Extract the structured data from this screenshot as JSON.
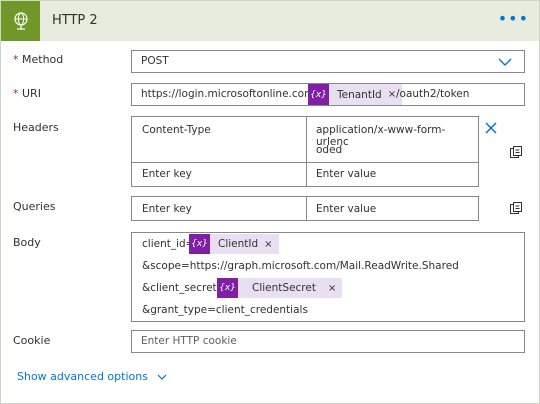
{
  "header": {
    "title": "HTTP 2",
    "icon": "globe-icon",
    "more_icon": "ellipsis-icon"
  },
  "method": {
    "label": "Method",
    "required_mark": "*",
    "value": "POST"
  },
  "uri": {
    "label": "URI",
    "required_mark": "*",
    "prefix": "https://login.microsoftonline.com/",
    "token": "TenantId",
    "suffix": "/oauth2/token"
  },
  "headers": {
    "label": "Headers",
    "rows": [
      {
        "key": "Content-Type",
        "value_line1": "application/x-www-form-urlenc",
        "value_line2": "oded"
      }
    ],
    "key_placeholder": "Enter key",
    "value_placeholder": "Enter value"
  },
  "queries": {
    "label": "Queries",
    "key_placeholder": "Enter key",
    "value_placeholder": "Enter value"
  },
  "body": {
    "label": "Body",
    "line1_prefix": "client_id=",
    "token1": "ClientId",
    "line2": "&scope=https://graph.microsoft.com/Mail.ReadWrite.Shared",
    "line3_prefix": "&client_secret=",
    "token2": "ClientSecret",
    "line4": "&grant_type=client_credentials"
  },
  "cookie": {
    "label": "Cookie",
    "placeholder": "Enter HTTP cookie"
  },
  "advanced": {
    "label": "Show advanced options"
  },
  "token_icon_text": "{x}",
  "token_remove": "×",
  "colors": {
    "header_bg": "#e7ecde",
    "icon_bg": "#709727",
    "token_icon": "#7e1fa6",
    "token_bg": "#e9dff3",
    "link": "#0078d4"
  }
}
